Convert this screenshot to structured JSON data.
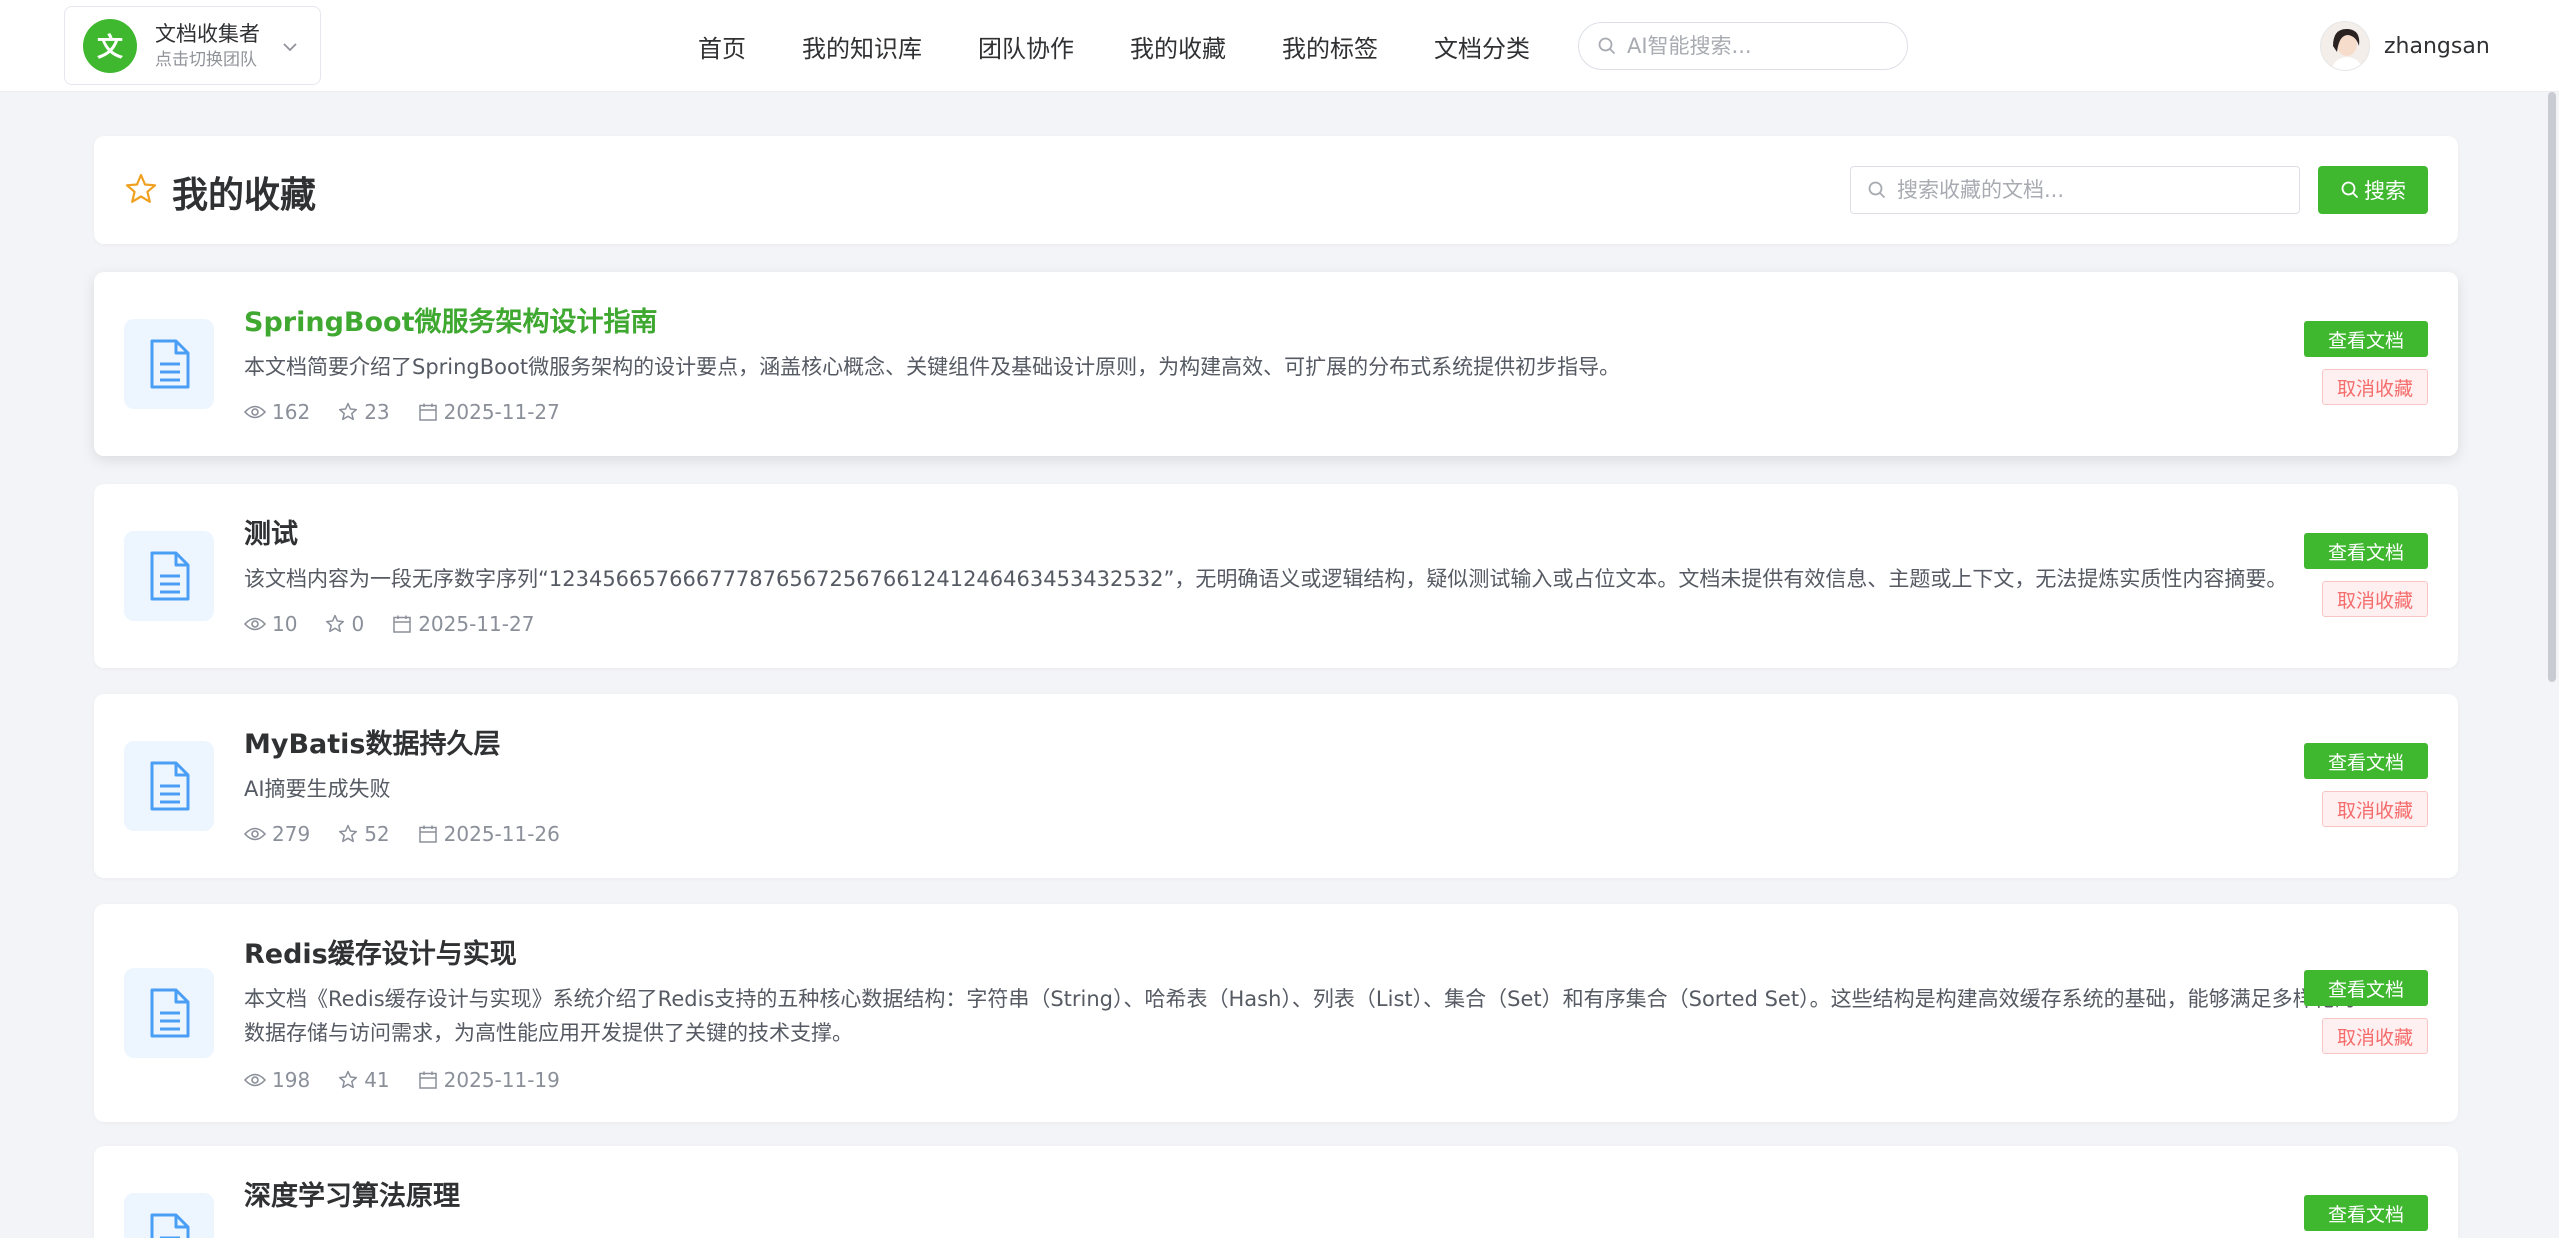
{
  "header": {
    "team": {
      "logo_char": "文",
      "name": "文档收集者",
      "hint": "点击切换团队"
    },
    "nav": [
      "首页",
      "我的知识库",
      "团队协作",
      "我的收藏",
      "我的标签",
      "文档分类"
    ],
    "ai_search_placeholder": "AI智能搜索...",
    "user": {
      "name": "zhangsan"
    }
  },
  "page": {
    "title": "我的收藏",
    "search_placeholder": "搜索收藏的文档...",
    "search_button": "搜索"
  },
  "actions": {
    "view": "查看文档",
    "unfavorite": "取消收藏"
  },
  "documents": [
    {
      "title": "SpringBoot微服务架构设计指南",
      "summary": "本文档简要介绍了SpringBoot微服务架构的设计要点，涵盖核心概念、关键组件及基础设计原则，为构建高效、可扩展的分布式系统提供初步指导。",
      "views": "162",
      "stars": "23",
      "date": "2025-11-27"
    },
    {
      "title": "测试",
      "summary": "该文档内容为一段无序数字序列“1234566576667778765672567661241246463453432532”，无明确语义或逻辑结构，疑似测试输入或占位文本。文档未提供有效信息、主题或上下文，无法提炼实质性内容摘要。",
      "views": "10",
      "stars": "0",
      "date": "2025-11-27"
    },
    {
      "title": "MyBatis数据持久层",
      "summary": "AI摘要生成失败",
      "views": "279",
      "stars": "52",
      "date": "2025-11-26"
    },
    {
      "title": "Redis缓存设计与实现",
      "summary": "本文档《Redis缓存设计与实现》系统介绍了Redis支持的五种核心数据结构：字符串（String）、哈希表（Hash）、列表（List）、集合（Set）和有序集合（Sorted Set）。这些结构是构建高效缓存系统的基础，能够满足多样化的数据存储与访问需求，为高性能应用开发提供了关键的技术支撑。",
      "views": "198",
      "stars": "41",
      "date": "2025-11-19"
    },
    {
      "title": "深度学习算法原理",
      "summary": "",
      "views": "",
      "stars": "",
      "date": ""
    }
  ],
  "colors": {
    "brand": "#3fb82f",
    "danger": "#f56c6c",
    "doc_icon": "#4a9ff5"
  }
}
